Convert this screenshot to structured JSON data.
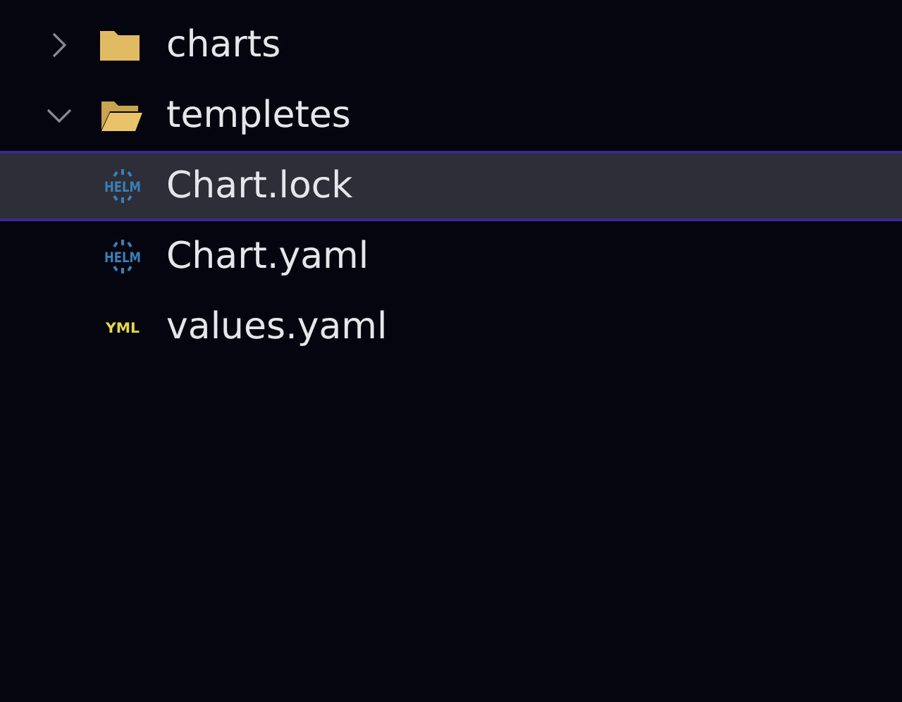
{
  "tree": [
    {
      "kind": "folder",
      "label": "charts",
      "expanded": false,
      "selected": false
    },
    {
      "kind": "folder",
      "label": "templetes",
      "expanded": true,
      "selected": false
    },
    {
      "kind": "helm",
      "icon_label": "HELM",
      "label": "Chart.lock",
      "selected": true
    },
    {
      "kind": "helm",
      "icon_label": "HELM",
      "label": "Chart.yaml",
      "selected": false
    },
    {
      "kind": "yaml",
      "icon_label": "YML",
      "label": "values.yaml",
      "selected": false
    }
  ]
}
